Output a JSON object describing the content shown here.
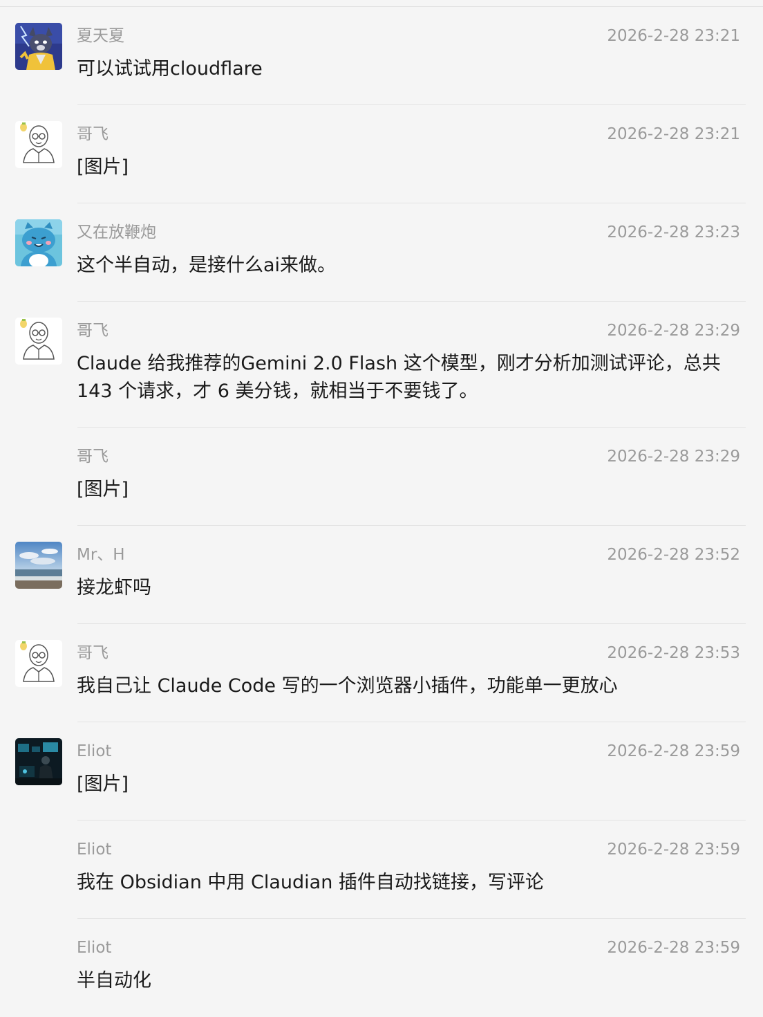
{
  "messages": [
    {
      "sender": "夏天夏",
      "time": "2026-2-28 23:21",
      "text": "可以试试用cloudflare",
      "avatar": "fox-avatar"
    },
    {
      "sender": "哥飞",
      "time": "2026-2-28 23:21",
      "text": "[图片]",
      "avatar": "bald-man-avatar"
    },
    {
      "sender": "又在放鞭炮",
      "time": "2026-2-28 23:23",
      "text": "这个半自动，是接什么ai来做。",
      "avatar": "blue-cat-avatar"
    },
    {
      "sender": "哥飞",
      "time": "2026-2-28 23:29",
      "text": "Claude 给我推荐的Gemini 2.0 Flash 这个模型，刚才分析加测试评论，总共 143 个请求，才 6 美分钱，就相当于不要钱了。",
      "avatar": "bald-man-avatar"
    },
    {
      "sender": "哥飞",
      "time": "2026-2-28 23:29",
      "text": "[图片]",
      "avatar": ""
    },
    {
      "sender": "Mr、H",
      "time": "2026-2-28 23:52",
      "text": "接龙虾吗",
      "avatar": "beach-avatar"
    },
    {
      "sender": "哥飞",
      "time": "2026-2-28 23:53",
      "text": "我自己让 Claude Code 写的一个浏览器小插件，功能单一更放心",
      "avatar": "bald-man-avatar"
    },
    {
      "sender": "Eliot",
      "time": "2026-2-28 23:59",
      "text": "[图片]",
      "avatar": "dark-room-avatar"
    },
    {
      "sender": "Eliot",
      "time": "2026-2-28 23:59",
      "text": "我在 Obsidian 中用 Claudian 插件自动找链接，写评论",
      "avatar": ""
    },
    {
      "sender": "Eliot",
      "time": "2026-2-28 23:59",
      "text": "半自动化",
      "avatar": ""
    }
  ]
}
